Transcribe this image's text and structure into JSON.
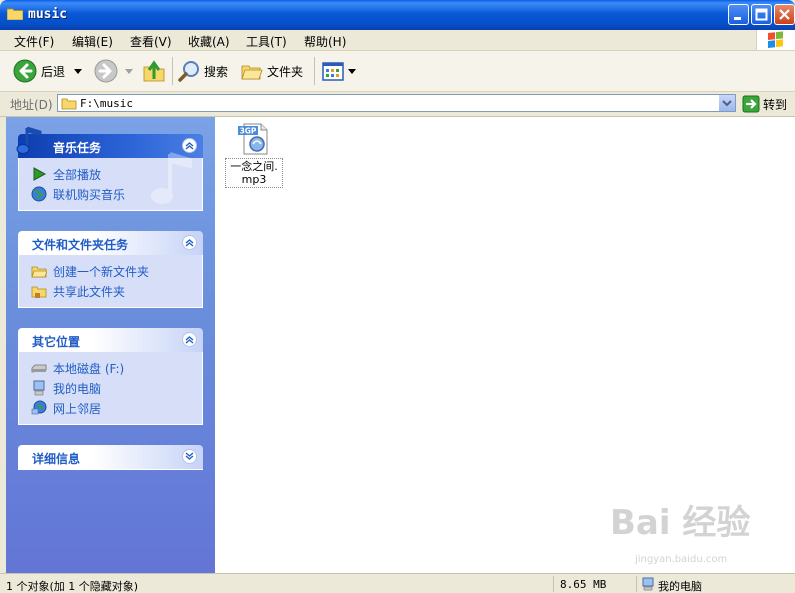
{
  "window": {
    "title": "music"
  },
  "menu": {
    "items": [
      "文件(F)",
      "编辑(E)",
      "查看(V)",
      "收藏(A)",
      "工具(T)",
      "帮助(H)"
    ]
  },
  "toolbar": {
    "back_label": "后退",
    "search_label": "搜索",
    "folders_label": "文件夹"
  },
  "address": {
    "label": "地址(D)",
    "value": "F:\\music",
    "go_label": "转到"
  },
  "task_pane": {
    "music_tasks": {
      "title": "音乐任务",
      "items": [
        "全部播放",
        "联机购买音乐"
      ]
    },
    "file_tasks": {
      "title": "文件和文件夹任务",
      "items": [
        "创建一个新文件夹",
        "共享此文件夹"
      ]
    },
    "other_places": {
      "title": "其它位置",
      "items": [
        "本地磁盘 (F:)",
        "我的电脑",
        "网上邻居"
      ]
    },
    "details": {
      "title": "详细信息"
    }
  },
  "files": [
    {
      "badge": "3GP",
      "name": "一念之间.mp3"
    }
  ],
  "status": {
    "objects": "1 个对象(加 1 个隐藏对象)",
    "size": "8.65 MB",
    "location": "我的电脑"
  },
  "watermark": {
    "main": "Bai 经验",
    "sub": "jingyan.baidu.com"
  },
  "colors": {
    "title_bar": "#0958D8",
    "task_pane": "#6A8FDC",
    "link": "#215DC6"
  }
}
